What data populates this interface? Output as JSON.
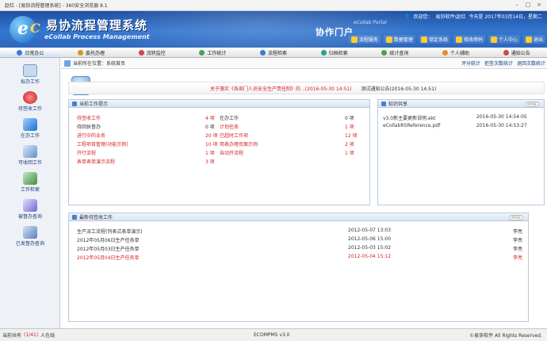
{
  "window": {
    "title": "赵红 - [易协流程管理系统] - 360安全浏览器 8.1"
  },
  "header": {
    "logo_letter": "e",
    "logo_c": "C",
    "app_name_cn": "易协流程管理系统",
    "app_name_en": "eCollab Process Management",
    "portal_en": "eCollab Portal",
    "portal_cn": "协作门户",
    "welcome": "欢迎您：",
    "user": "易协软件\\赵红",
    "date": "今天是 2017年03月14日，星期二"
  },
  "topnav": [
    "流程服务",
    "数据管理",
    "锁定系统",
    "修改密码",
    "个人中心",
    "退出"
  ],
  "menubar": [
    {
      "label": "日常办公",
      "color": "#3a7bd5"
    },
    {
      "label": "委托办理",
      "color": "#e0902a"
    },
    {
      "label": "流转监控",
      "color": "#d64545"
    },
    {
      "label": "工作统计",
      "color": "#4aa34a"
    },
    {
      "label": "流程检索",
      "color": "#3a7bd5"
    },
    {
      "label": "归档检索",
      "color": "#2e9e8f"
    },
    {
      "label": "统计查询",
      "color": "#4aa34a"
    },
    {
      "label": "个人辅助",
      "color": "#e0902a"
    },
    {
      "label": "通知公告",
      "color": "#d64545"
    }
  ],
  "sidebar": [
    {
      "label": "拟办工作",
      "color": "#c9d9ef"
    },
    {
      "label": "待签收工作",
      "color": "#d93f3f"
    },
    {
      "label": "在办工作",
      "color": "#3f8be0"
    },
    {
      "label": "可收回工作",
      "color": "#5d8fd0"
    },
    {
      "label": "工作检索",
      "color": "#4a9e4a"
    },
    {
      "label": "被督办查询",
      "color": "#6a6ad0"
    },
    {
      "label": "已发督办查询",
      "color": "#5a7ec0"
    }
  ],
  "breadcrumb": {
    "text": "当前所在位置：系统首页",
    "actions": [
      "评分统计",
      "拒签次数统计",
      "退回次数统计"
    ]
  },
  "notice": {
    "warning": "关于落实《各部门人员安全生产责任制》的 ..(2016-05-30 14:51)",
    "notice2": "测试通知公告(2016-05-30 14:51)"
  },
  "work_panel": {
    "title": "当前工作提示",
    "left": [
      {
        "label": "待签收工作",
        "value": "4 项",
        "red": true
      },
      {
        "label": "待回执督办",
        "value": "0 项",
        "red": false
      },
      {
        "label": "进行中的业务",
        "value": "20 项",
        "red": true
      },
      {
        "label": "工程项目管理(功能示例)",
        "value": "10 项",
        "red": true
      },
      {
        "label": "开行流程",
        "value": "1 项",
        "red": true
      },
      {
        "label": "表单表单演示流程",
        "value": "3 项",
        "red": true
      }
    ],
    "right": [
      {
        "label": "在办工作",
        "value": "0 项",
        "red": false
      },
      {
        "label": "计划任务",
        "value": "1 项",
        "red": true
      },
      {
        "label": "已超时工作项",
        "value": "12 项",
        "red": true
      },
      {
        "label": "简表办理页面示例",
        "value": "2 项",
        "red": true
      },
      {
        "label": "自动开流程",
        "value": "1 项",
        "red": true
      }
    ]
  },
  "knowledge_panel": {
    "title": "知识共享",
    "more": "MORE",
    "items": [
      {
        "name": "v3.0新主要更新说明.ekt",
        "date": "2016-05-30 14:54:05"
      },
      {
        "name": "eCollabRSReference.pdf",
        "date": "2016-05-30 14:53:27"
      }
    ]
  },
  "latest_panel": {
    "title": "最新待签收工作",
    "more": "MORE",
    "rows": [
      {
        "name": "生产派工流程(列表式表单演示)",
        "date": "2012-05-07 13:03",
        "user": "李亮",
        "red": false
      },
      {
        "name": "2012年05月06日生产任务单",
        "date": "2012-05-06 15:00",
        "user": "李亮",
        "red": false
      },
      {
        "name": "2012年05月03日生产任务单",
        "date": "2012-05-03 15:02",
        "user": "李亮",
        "red": false
      },
      {
        "name": "2012年05月04日生产任务单",
        "date": "2012-05-04 15:12",
        "user": "李亮",
        "red": true
      }
    ]
  },
  "status": {
    "online_prefix": "当前共有",
    "online_count": "(1/41)",
    "online_suffix": "人在线",
    "version": "ECOMPMS v3.0",
    "copyright": "©易协软件  All Rights Reserved."
  }
}
